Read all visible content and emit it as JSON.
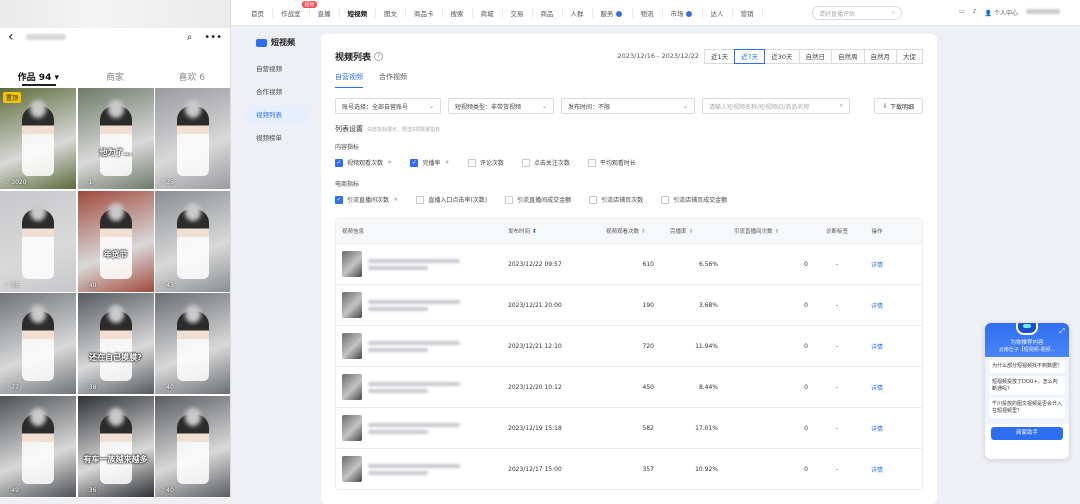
{
  "phone": {
    "tabs": [
      "作品 94 ▾",
      "商家",
      "喜欢 6"
    ],
    "pin_label": "置顶",
    "videos": [
      {
        "caption": "",
        "likes": "3020",
        "pinned": true,
        "bg": "#5d6b3a"
      },
      {
        "caption": "他为了…",
        "likes": "1",
        "pinned": false,
        "bg": "#6e7a6a"
      },
      {
        "caption": "",
        "likes": "35",
        "pinned": false,
        "bg": "#9a9aa0"
      },
      {
        "caption": "",
        "likes": "35",
        "pinned": false,
        "bg": "#c8c8cc"
      },
      {
        "caption": "年货节",
        "likes": "40",
        "pinned": false,
        "bg": "#a1493c"
      },
      {
        "caption": "",
        "likes": "43",
        "pinned": false,
        "bg": "#8a8e92"
      },
      {
        "caption": "",
        "likes": "77",
        "pinned": false,
        "bg": "#707478"
      },
      {
        "caption": "还在自己摸膜?",
        "likes": "38",
        "pinned": false,
        "bg": "#555a5f"
      },
      {
        "caption": "",
        "likes": "40",
        "pinned": false,
        "bg": "#6a6d72"
      },
      {
        "caption": "",
        "likes": "49",
        "pinned": false,
        "bg": "#4f5256"
      },
      {
        "caption": "有车一族越来越多",
        "likes": "36",
        "pinned": false,
        "bg": "#2f3134"
      },
      {
        "caption": "",
        "likes": "40",
        "pinned": false,
        "bg": "#5a5c60"
      }
    ]
  },
  "topnav": {
    "items": [
      "首页",
      "作战室",
      "直播",
      "短视频",
      "图文",
      "商品卡",
      "搜索",
      "商城",
      "交易",
      "商品",
      "人群",
      "服务",
      "物流",
      "市场",
      "达人",
      "营销"
    ],
    "active": "短视频",
    "badge": "超级",
    "search_placeholder": "请好直播评估",
    "personal": "个人中心"
  },
  "sidenav": {
    "title": "短视频",
    "items": [
      "自营视频",
      "合作视频",
      "视频列表",
      "视频榜单"
    ],
    "active": "视频列表"
  },
  "main": {
    "title": "视频列表",
    "date_range": "2023/12/16 - 2023/12/22",
    "date_buttons": [
      "近1天",
      "近7天",
      "近30天",
      "自然日",
      "自然周",
      "自然月",
      "大促"
    ],
    "date_selected": "近7天",
    "subtabs": [
      "自营视频",
      "合作视频"
    ],
    "filters": {
      "account": "账号选择：全部自营账号",
      "video_type": "短视频类型：非带货视频",
      "publish_time": "发布时间：不限",
      "search_placeholder": "请输入短视频名称/短视频ID/商品名称",
      "download": "下载明细"
    },
    "colset_title": "列表设置",
    "colset_hint": "勾选指标展示，限选9项数据指标",
    "content_group": "内容指标",
    "content_metrics": [
      {
        "label": "视频观看次数",
        "checked": true,
        "star": true
      },
      {
        "label": "完播率",
        "checked": true,
        "star": true
      },
      {
        "label": "评论次数",
        "checked": false,
        "star": false
      },
      {
        "label": "点击关注次数",
        "checked": false,
        "star": false
      },
      {
        "label": "平均观看时长",
        "checked": false,
        "star": false
      }
    ],
    "commerce_group": "电商指标",
    "commerce_metrics": [
      {
        "label": "引流直播间次数",
        "checked": true,
        "star": true
      },
      {
        "label": "直播入口点击率(次数)",
        "checked": false,
        "star": false
      },
      {
        "label": "引流直播间成交金额",
        "checked": false,
        "star": false
      },
      {
        "label": "引流店铺页次数",
        "checked": false,
        "star": false
      },
      {
        "label": "引流店铺页成交金额",
        "checked": false,
        "star": false
      }
    ],
    "table": {
      "headers": [
        "视频信息",
        "发布时间",
        "视频观看次数",
        "完播率",
        "引流直播间次数",
        "诊断标签",
        "操作"
      ],
      "sort_icon": "⬍",
      "rows": [
        {
          "time": "2023/12/22 09:57",
          "views": "610",
          "rate": "6.56%",
          "live": "0",
          "tag": "-",
          "op": "详情"
        },
        {
          "time": "2023/12/21 20:00",
          "views": "190",
          "rate": "3.68%",
          "live": "0",
          "tag": "-",
          "op": "详情"
        },
        {
          "time": "2023/12/21 12:10",
          "views": "720",
          "rate": "11.94%",
          "live": "0",
          "tag": "-",
          "op": "详情"
        },
        {
          "time": "2023/12/20 10:12",
          "views": "450",
          "rate": "8.44%",
          "live": "0",
          "tag": "-",
          "op": "详情"
        },
        {
          "time": "2023/12/19 15:18",
          "views": "582",
          "rate": "17.01%",
          "live": "0",
          "tag": "-",
          "op": "详情"
        },
        {
          "time": "2023/12/17 15:00",
          "views": "357",
          "rate": "10.92%",
          "live": "0",
          "tag": "-",
          "op": "详情"
        }
      ]
    }
  },
  "assistant": {
    "title": "为你推荐内容",
    "subtitle": "云南仕子【短视频-视频...",
    "questions": [
      "为什么部分短视频找不到数据？",
      "短视频投放了DOU+，怎么判断通吗？",
      "千川投放的图文视频是否会计入在短视频里？"
    ],
    "button": "商家助手",
    "accent": "#2e6ff2"
  }
}
